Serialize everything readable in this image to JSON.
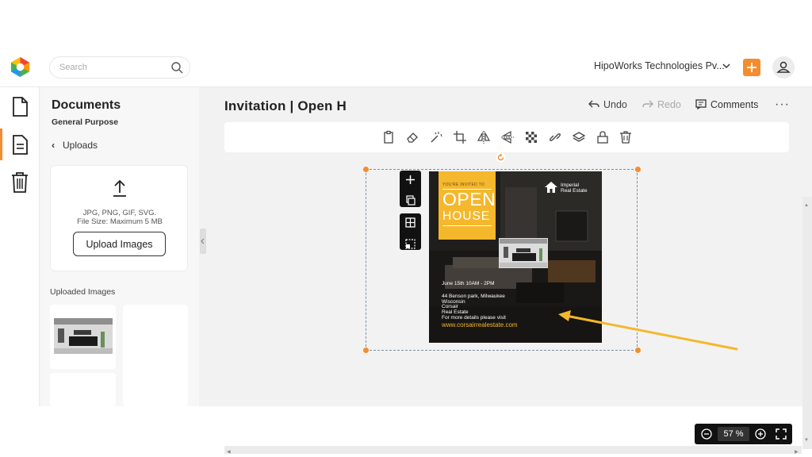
{
  "header": {
    "search_placeholder": "Search",
    "org_name": "HipoWorks Technologies Pv...",
    "brand_color": "#f58c2e"
  },
  "rail": {
    "items": [
      {
        "icon": "document-icon"
      },
      {
        "icon": "template-icon",
        "active": true
      },
      {
        "icon": "trash-icon"
      }
    ]
  },
  "panel": {
    "title": "Documents",
    "subtitle": "General Purpose",
    "back_label": "Uploads",
    "upload_types": "JPG, PNG, GIF, SVG.",
    "upload_size": "File Size: Maximum 5 MB",
    "upload_button": "Upload Images",
    "uploaded_label": "Uploaded Images"
  },
  "main": {
    "doc_title": "Invitation | Open H",
    "undo": "Undo",
    "redo": "Redo",
    "comments": "Comments",
    "more": "···",
    "toolbar_icons": [
      "clipboard-icon",
      "eraser-icon",
      "magic-wand-icon",
      "crop-icon",
      "flip-horizontal-icon",
      "flip-vertical-icon",
      "transparency-icon",
      "link-icon",
      "layers-icon",
      "lock-icon",
      "trash-icon"
    ]
  },
  "flyer": {
    "invited": "YOU'RE INVITED TO",
    "open": "OPEN",
    "house": "HOUSE",
    "brand_line1": "Imperial",
    "brand_line2": "Real Estate",
    "date": "June 15th 10AM - 2PM",
    "address1": "44 Benson park, Milwaukee",
    "address2": "Wisconsin",
    "company1": "Corsair",
    "company2": "Real Estate",
    "details": "For more details please visit",
    "url": "www.corsairrealestate.com",
    "accent": "#f5b72c"
  },
  "zoom": {
    "value": "57 %"
  }
}
